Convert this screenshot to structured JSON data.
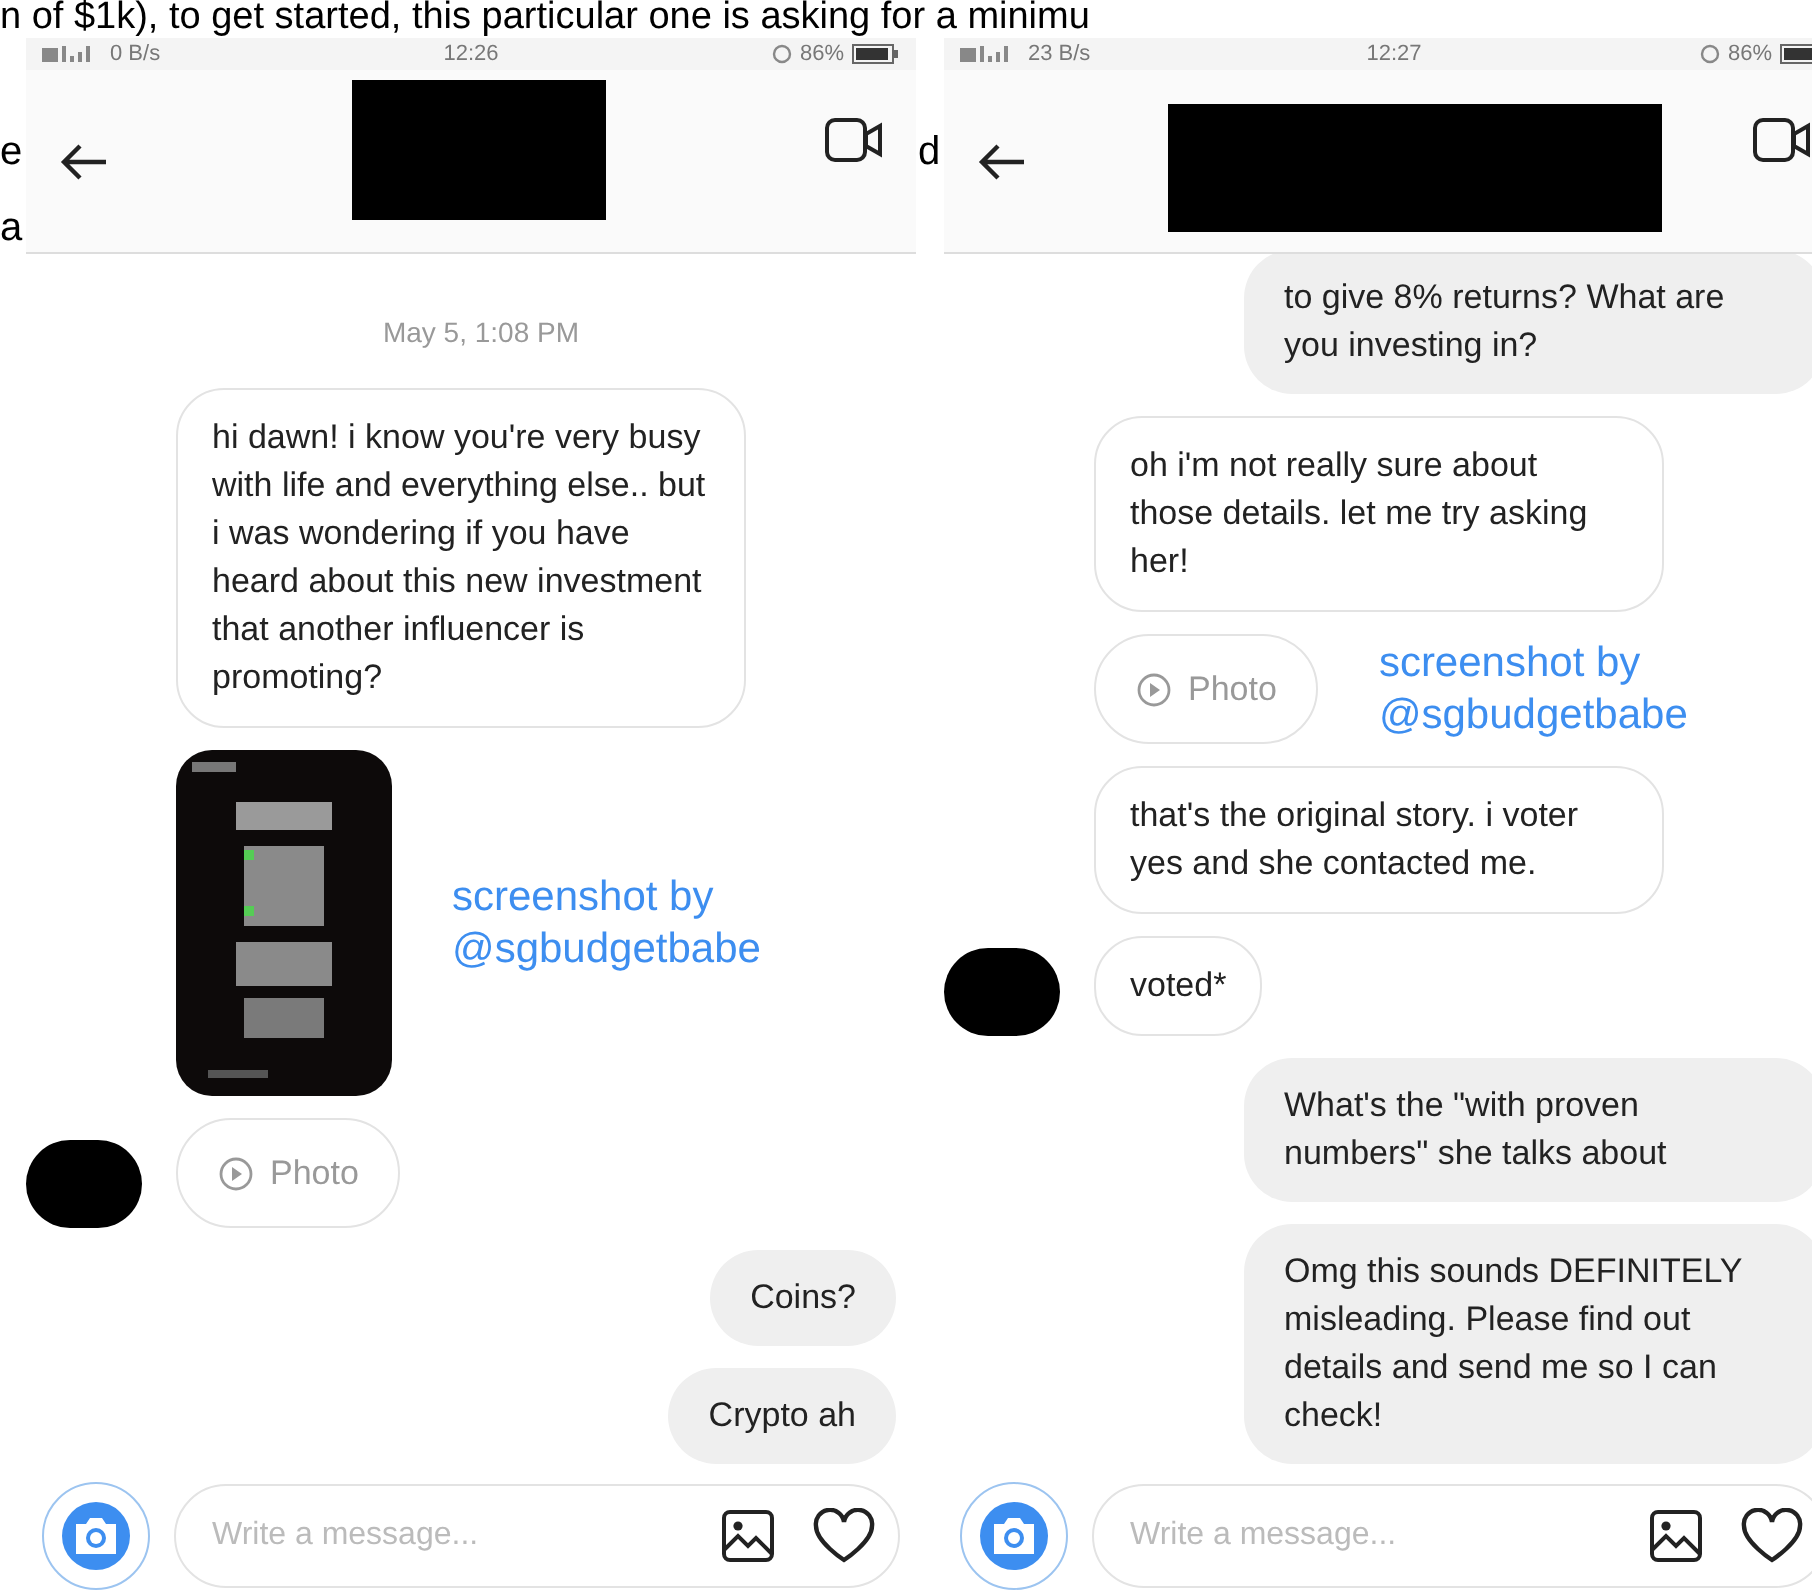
{
  "background_text": {
    "top_line": "n of $1k), to get started, this particular one is asking for a minimu",
    "fragments": [
      "e",
      "a",
      "d"
    ]
  },
  "phones": [
    {
      "status_bar": {
        "network": "0 B/s",
        "time": "12:26",
        "battery": "86%"
      },
      "messages": [
        {
          "kind": "date",
          "text": "May 5, 1:08 PM"
        },
        {
          "kind": "incoming",
          "text": "hi dawn! i know you're very busy with life and everything else.. but i was wondering if you have heard about this new investment that another influencer is promoting?",
          "avatar": false
        },
        {
          "kind": "story",
          "caption": [
            "screenshot by",
            "@sgbudgetbabe"
          ]
        },
        {
          "text": "Photo",
          "avatar": true
        },
        {
          "kind": "outgoing",
          "text": "Coins?"
        },
        {
          "kind": "outgoing",
          "text": "Crypto ah"
        }
      ],
      "composer": {
        "placeholder": "Write a message..."
      }
    },
    {
      "status_bar": {
        "network": "23 B/s",
        "time": "12:27",
        "battery": "86%"
      },
      "messages": [
        {
          "kind": "outgoing",
          "text": "to give 8% returns? What are you investing in?"
        },
        {
          "kind": "incoming",
          "text": "oh i'm not really sure about those details. let me try asking her!",
          "avatar": false
        },
        {
          "text": "Photo",
          "avatar": false,
          "caption": [
            "screenshot by",
            "@sgbudgetbabe"
          ]
        },
        {
          "kind": "incoming",
          "text": "that's the original story. i voter yes and she contacted me.",
          "avatar": false
        },
        {
          "kind": "incoming",
          "text": "voted*",
          "avatar": true
        },
        {
          "kind": "outgoing",
          "text": "What's the \"with proven numbers\" she talks about"
        },
        {
          "kind": "outgoing",
          "text": "Omg this sounds DEFINITELY misleading. Please find out details and send me so I can check!"
        }
      ],
      "composer": {
        "placeholder": "Write a message..."
      }
    }
  ]
}
